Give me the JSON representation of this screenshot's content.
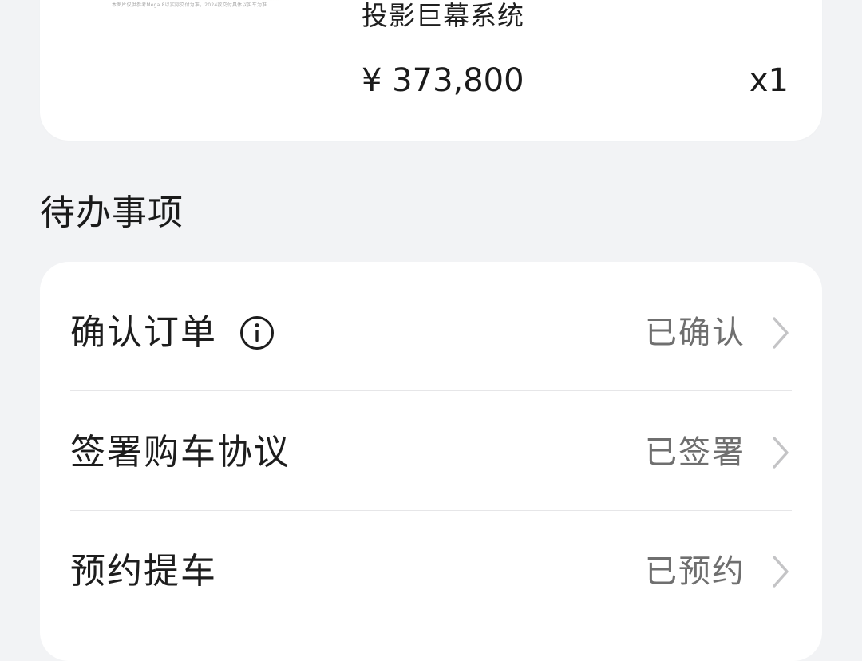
{
  "product": {
    "thumb_caption": "本图片仅供参考Mega 8以实际交付为准，2024款交付具体以实车为准",
    "name": "投影巨幕系统",
    "price": "¥ 373,800",
    "qty": "x1"
  },
  "todo": {
    "title": "待办事项",
    "items": [
      {
        "label": "确认订单",
        "status": "已确认",
        "has_info_icon": true
      },
      {
        "label": "签署购车协议",
        "status": "已签署",
        "has_info_icon": false
      },
      {
        "label": "预约提车",
        "status": "已预约",
        "has_info_icon": false
      }
    ]
  },
  "colors": {
    "background": "#f2f3f5",
    "card": "#ffffff",
    "primary_text": "#1f1f1f",
    "secondary_text": "#6f6f6f",
    "divider": "#e6e6e8",
    "chevron": "#c4c4c6"
  }
}
